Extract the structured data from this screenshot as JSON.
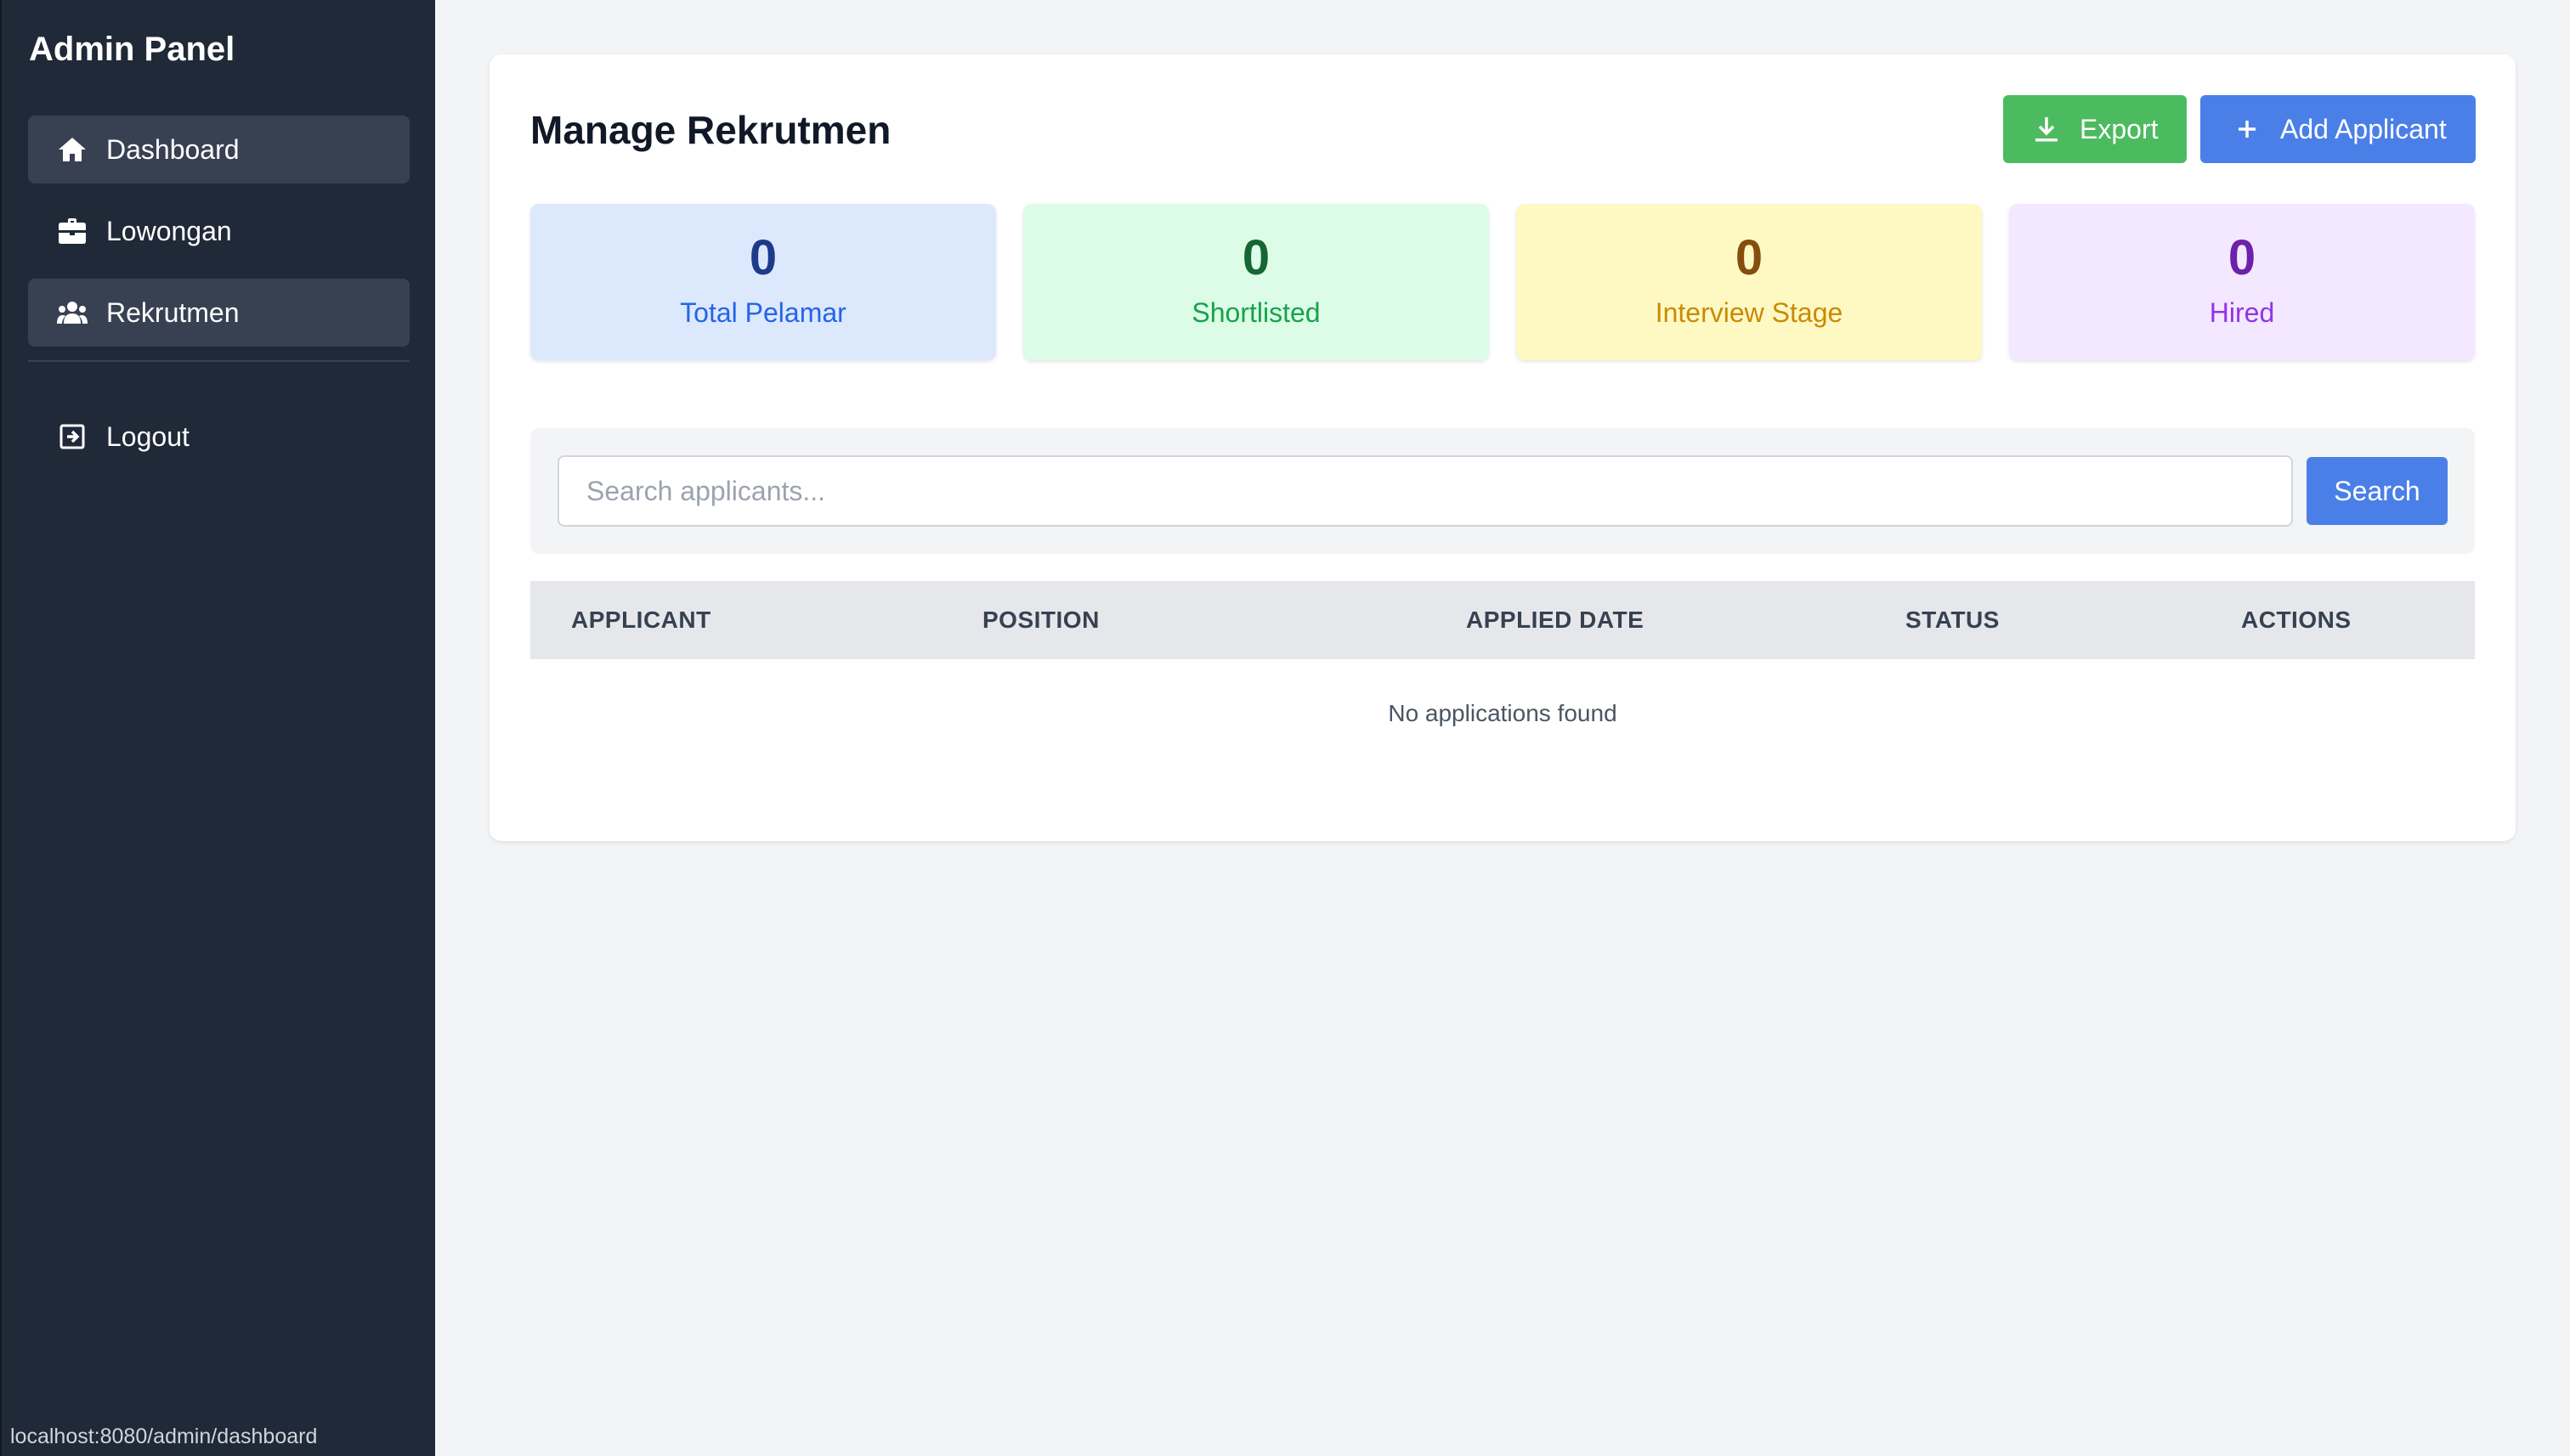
{
  "sidebar": {
    "title": "Admin Panel",
    "items": [
      {
        "label": "Dashboard",
        "icon": "home-icon",
        "active": true
      },
      {
        "label": "Lowongan",
        "icon": "briefcase-icon",
        "active": false
      },
      {
        "label": "Rekrutmen",
        "icon": "users-icon",
        "active": true
      }
    ],
    "logout": {
      "label": "Logout",
      "icon": "logout-icon"
    }
  },
  "status_bar": {
    "url": "localhost:8080/admin/dashboard"
  },
  "main": {
    "title": "Manage Rekrutmen",
    "export_label": "Export",
    "add_label": "Add Applicant",
    "stats": [
      {
        "value": "0",
        "label": "Total Pelamar"
      },
      {
        "value": "0",
        "label": "Shortlisted"
      },
      {
        "value": "0",
        "label": "Interview Stage"
      },
      {
        "value": "0",
        "label": "Hired"
      }
    ],
    "search": {
      "placeholder": "Search applicants...",
      "value": "",
      "button_label": "Search"
    },
    "table": {
      "columns": [
        "APPLICANT",
        "POSITION",
        "APPLIED DATE",
        "STATUS",
        "ACTIONS"
      ],
      "rows": [],
      "empty_message": "No applications found"
    }
  },
  "colors": {
    "sidebar_bg": "#1f2937",
    "export_button": "#4cbb5f",
    "primary_button": "#4a7fe8"
  }
}
